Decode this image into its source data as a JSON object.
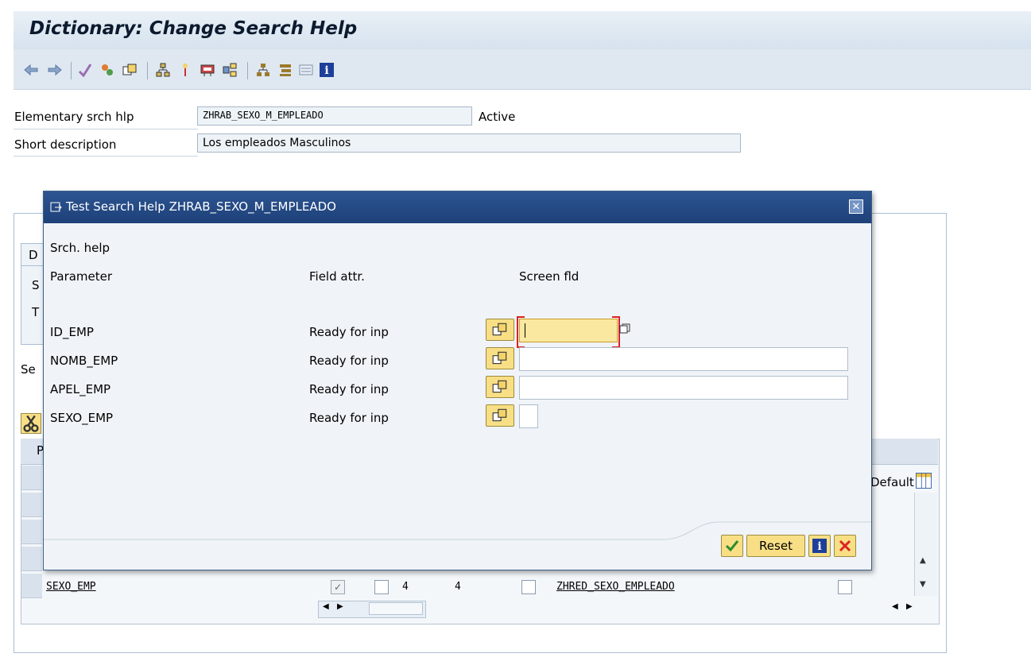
{
  "window": {
    "title": "Dictionary: Change Search Help"
  },
  "header": {
    "elementary_label": "Elementary srch hlp",
    "elementary_value": "ZHRAB_SEXO_M_EMPLEADO",
    "status": "Active",
    "shortdesc_label": "Short description",
    "shortdesc_value": "Los empleados Masculinos"
  },
  "background": {
    "tab_fragment": "D",
    "row_fragment_1": "S",
    "row_fragment_2": "T",
    "section_fragment": "Se",
    "grid_head_fragment": "P",
    "default_label": "Default",
    "visible_row": {
      "param": "SEXO_EMP",
      "len1": "4",
      "len2": "4",
      "data_element": "ZHRED_SEXO_EMPLEADO"
    }
  },
  "dialog": {
    "title": "Test Search Help ZHRAB_SEXO_M_EMPLEADO",
    "srch_help_label": "Srch. help",
    "col_parameter": "Parameter",
    "col_field_attr": "Field attr.",
    "col_screen_fld": "Screen fld",
    "rows": [
      {
        "param": "ID_EMP",
        "attr": "Ready for inp",
        "value": ""
      },
      {
        "param": "NOMB_EMP",
        "attr": "Ready for inp",
        "value": ""
      },
      {
        "param": "APEL_EMP",
        "attr": "Ready for inp",
        "value": ""
      },
      {
        "param": "SEXO_EMP",
        "attr": "Ready for inp",
        "value": ""
      }
    ],
    "reset_label": "Reset"
  },
  "colors": {
    "dialog_title": "#1e4078",
    "f4_button": "#f8df85",
    "active_input": "#fbe8a0"
  }
}
